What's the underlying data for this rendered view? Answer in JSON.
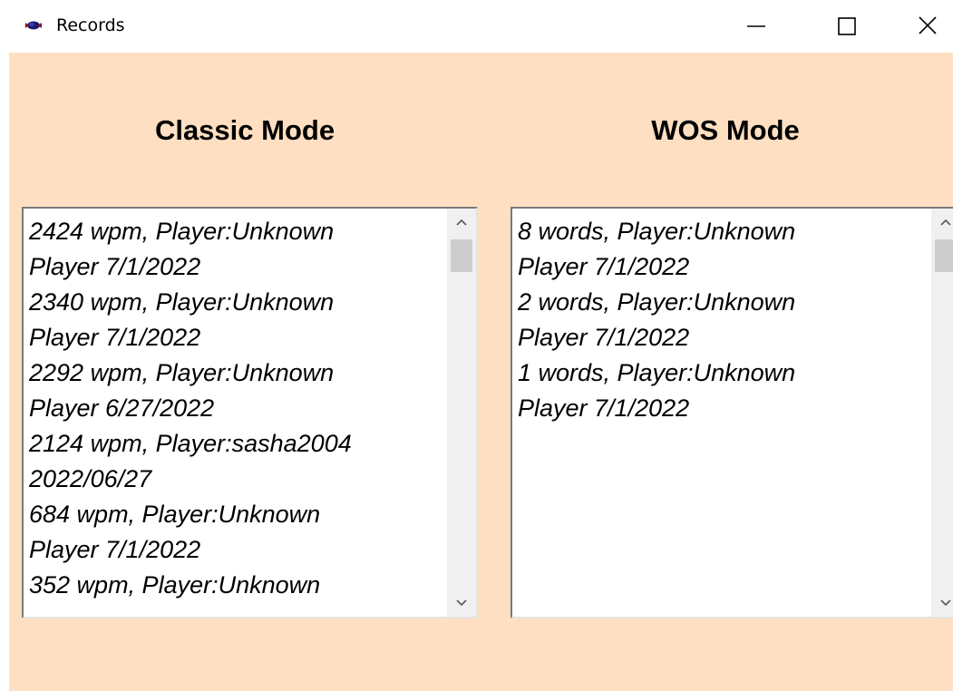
{
  "window": {
    "title": "Records",
    "icon": "app-icon"
  },
  "classic": {
    "heading": "Classic Mode",
    "items": [
      "2424 wpm, Player:Unknown\nPlayer 7/1/2022",
      "2340 wpm, Player:Unknown\nPlayer 7/1/2022",
      "2292 wpm, Player:Unknown\nPlayer 6/27/2022",
      "2124 wpm, Player:sasha2004\n2022/06/27",
      "684 wpm, Player:Unknown\nPlayer 7/1/2022",
      "352 wpm, Player:Unknown"
    ]
  },
  "wos": {
    "heading": "WOS Mode",
    "items": [
      "8 words, Player:Unknown\nPlayer 7/1/2022",
      "2 words, Player:Unknown\nPlayer 7/1/2022",
      "1 words, Player:Unknown\nPlayer 7/1/2022"
    ]
  },
  "colors": {
    "client_background": "#ffdfc2",
    "list_background": "#ffffff",
    "scrollbar_track": "#f0f0f0",
    "scrollbar_thumb": "#cdcdcd"
  }
}
